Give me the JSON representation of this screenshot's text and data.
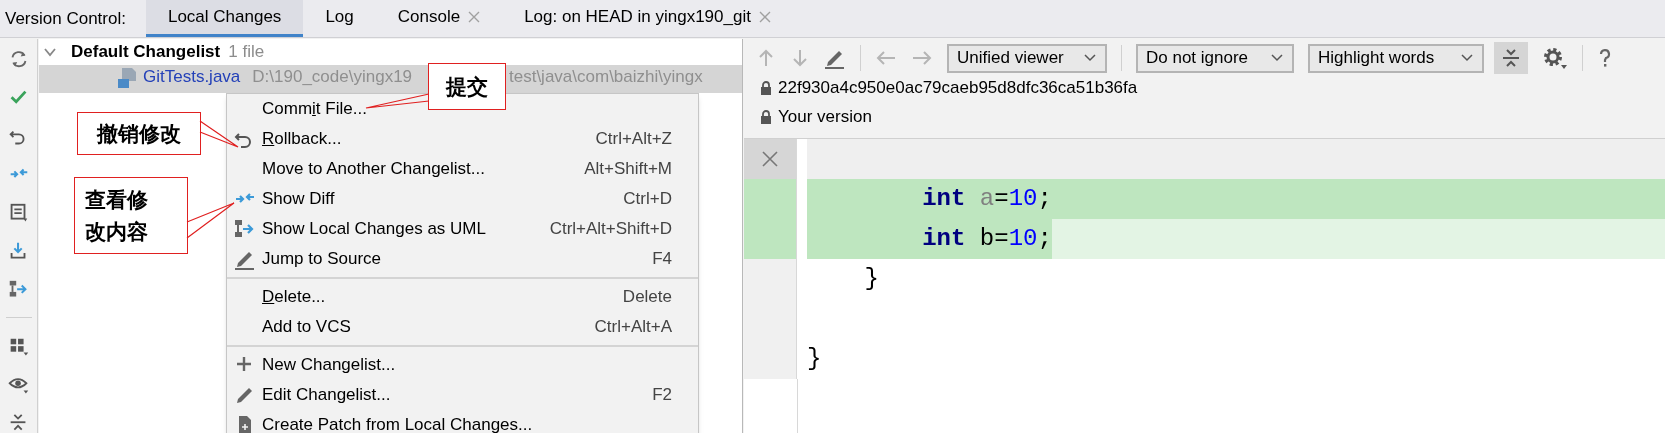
{
  "tool_window": {
    "title": "Version Control:",
    "tabs": [
      {
        "label": "Local Changes",
        "selected": true,
        "closable": false
      },
      {
        "label": "Log",
        "selected": false,
        "closable": false
      },
      {
        "label": "Console",
        "selected": false,
        "closable": true
      },
      {
        "label": "Log: on HEAD in yingx190_git",
        "selected": false,
        "closable": true
      }
    ]
  },
  "changes_tree": {
    "changelist": {
      "name": "Default Changelist",
      "count": "1 file",
      "expanded": true
    },
    "file": {
      "name": "GitTests.java",
      "path_start": "D:\\190_code\\yingx19",
      "path_end": "test\\java\\com\\baizhi\\yingx",
      "selected": true
    }
  },
  "context_menu": {
    "groups": [
      [
        {
          "before": "Comm",
          "mnemonic": "i",
          "after": "t File..."
        },
        {
          "mnemonic": "R",
          "after": "ollback...",
          "shortcut": "Ctrl+Alt+Z"
        },
        {
          "after": "Move to Another Changelist...",
          "shortcut": "Alt+Shift+M"
        },
        {
          "after": "Show Diff",
          "shortcut": "Ctrl+D"
        },
        {
          "after": "Show Local Changes as UML",
          "shortcut": "Ctrl+Alt+Shift+D"
        },
        {
          "after": "Jump to Source",
          "shortcut": "F4"
        }
      ],
      [
        {
          "mnemonic": "D",
          "after": "elete...",
          "shortcut": "Delete"
        },
        {
          "after": "Add to VCS",
          "shortcut": "Ctrl+Alt+A"
        }
      ],
      [
        {
          "after": "New Changelist..."
        },
        {
          "after": "Edit Changelist...",
          "shortcut": "F2"
        },
        {
          "after": "Create Patch from Local Changes..."
        }
      ]
    ]
  },
  "callouts": [
    {
      "text": "提交"
    },
    {
      "text": "撤销修改"
    },
    {
      "text": "查看修改内容"
    }
  ],
  "diff_viewer": {
    "toolbar": {
      "viewer": "Unified viewer",
      "ignore": "Do not ignore",
      "highlight": "Highlight words",
      "collapse_selected": true
    },
    "revisions": [
      "22f930a4c950e0ac79caeb95d8dfc36ca51b36fa",
      "Your version"
    ],
    "lines": [
      {
        "kind": "header"
      },
      {
        "kind": "added",
        "tokens": [
          {
            "text": "        int",
            "kind": "keyword"
          },
          {
            "text": " a",
            "kind": "unused"
          },
          {
            "text": "=",
            "kind": "plain"
          },
          {
            "text": "10",
            "kind": "number"
          },
          {
            "text": ";",
            "kind": "plain"
          }
        ]
      },
      {
        "kind": "added_partial",
        "tokens": [
          {
            "text": "        int",
            "kind": "keyword"
          },
          {
            "text": " b=",
            "kind": "plain"
          },
          {
            "text": "10",
            "kind": "number"
          },
          {
            "text": ";",
            "kind": "plain"
          }
        ]
      },
      {
        "kind": "context",
        "tokens": [
          {
            "text": "    }",
            "kind": "plain"
          }
        ]
      },
      {
        "kind": "context"
      },
      {
        "kind": "context",
        "tokens": [
          {
            "text": "}",
            "kind": "plain"
          }
        ]
      }
    ]
  }
}
